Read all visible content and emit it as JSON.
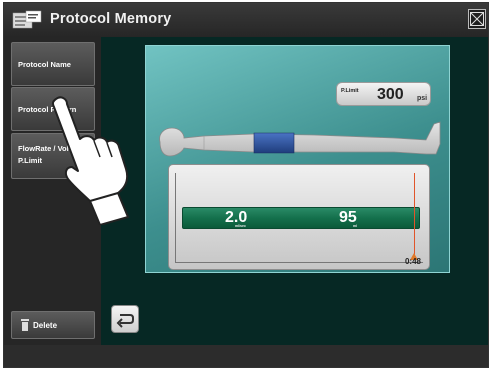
{
  "window": {
    "title": "Protocol Memory",
    "app_icon": "protocol-memory-icon",
    "close_icon": "close-icon"
  },
  "sidebar": {
    "items": [
      {
        "label": "Protocol Name"
      },
      {
        "label": "Protocol Pattern"
      },
      {
        "line1": "FlowRate / Volume",
        "line2": "P.Limit"
      }
    ],
    "delete_label": "Delete",
    "delete_icon": "trash-icon"
  },
  "pressure_limit": {
    "label": "P.Limit",
    "value": "300",
    "unit": "psi"
  },
  "injection": {
    "flow_rate": "2.0",
    "flow_unit": "ml/sec",
    "volume": "95",
    "volume_unit": "ml",
    "duration": "0:48"
  },
  "colors": {
    "panel": "#4fa3a2",
    "flow_bar": "#14704c",
    "body_highlight": "#2b4f9a",
    "marker": "#e0552a"
  },
  "icons": {
    "back": "back-arrow-icon",
    "hand": "pointing-hand-icon",
    "body": "patient-body-icon"
  }
}
